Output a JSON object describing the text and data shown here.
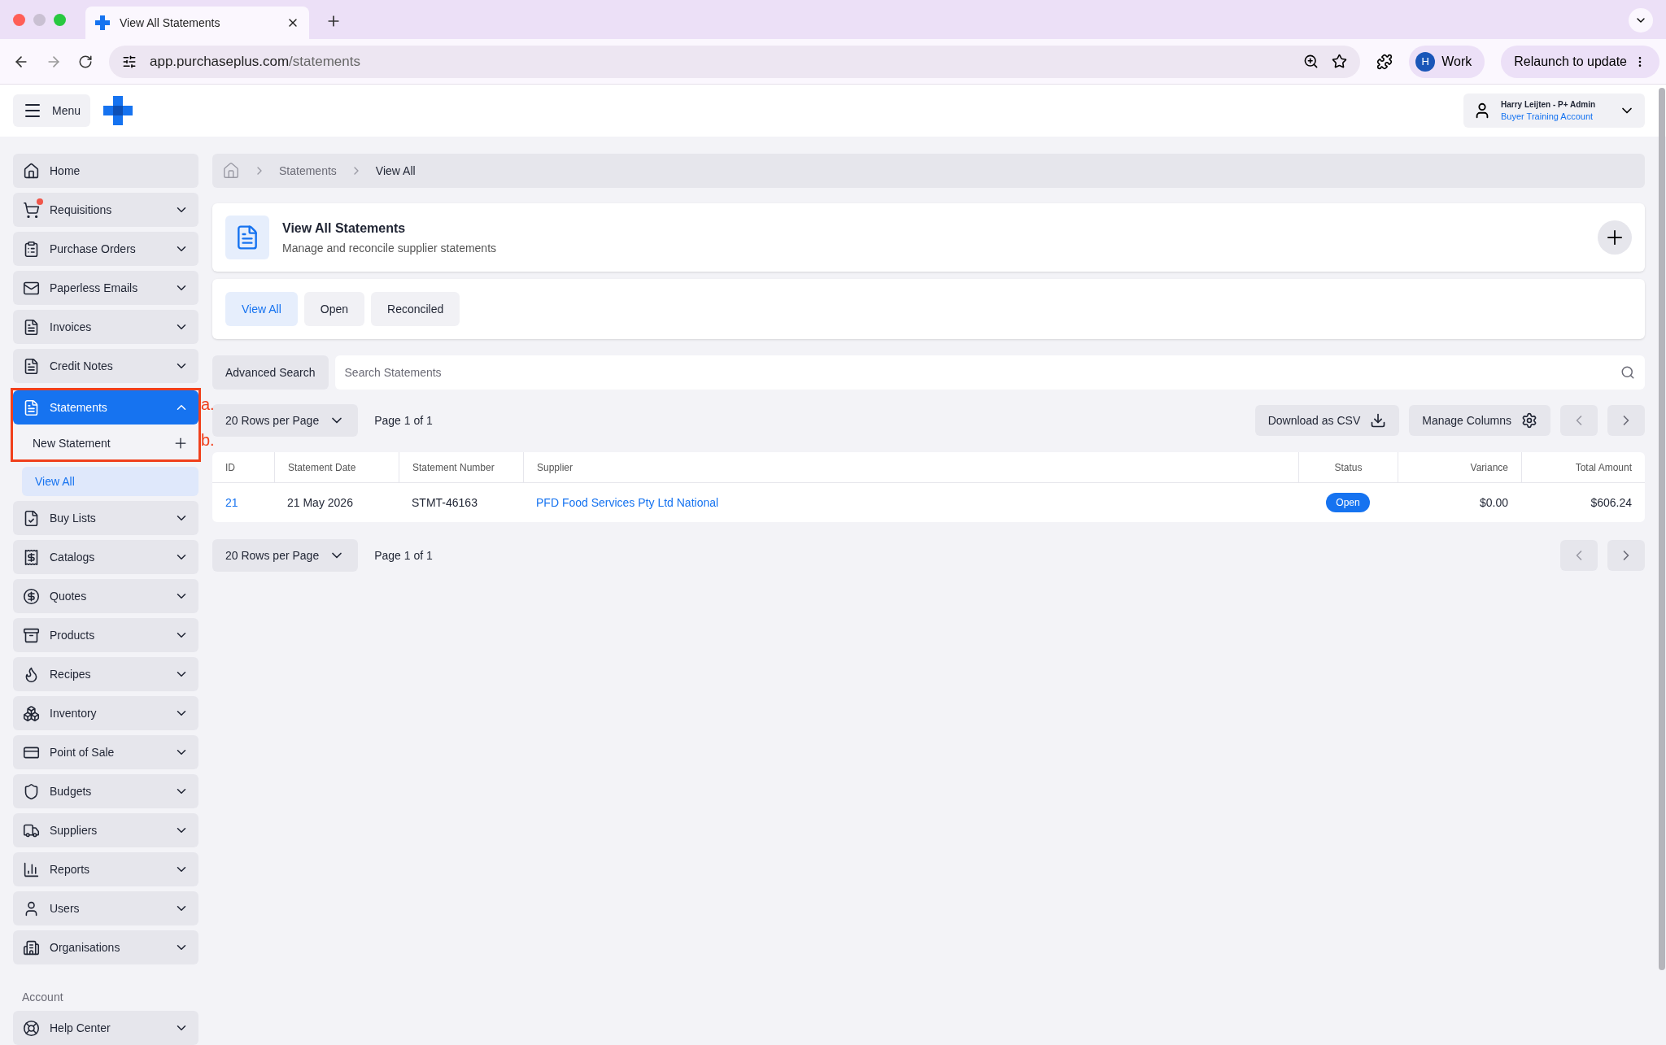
{
  "browser": {
    "tab_title": "View All Statements",
    "url_domain": "app.purchaseplus.com",
    "url_path": "/statements",
    "profile_initial": "H",
    "profile_name": "Work",
    "relaunch": "Relaunch to update"
  },
  "header": {
    "menu_label": "Menu",
    "user_name": "Harry Leijten - P+ Admin",
    "account": "Buyer Training Account"
  },
  "sidebar": {
    "items": [
      {
        "label": "Home",
        "expandable": false,
        "selected": false,
        "alert": false
      },
      {
        "label": "Requisitions",
        "expandable": true,
        "expanded": false,
        "selected": false,
        "alert": true
      },
      {
        "label": "Purchase Orders",
        "expandable": true,
        "expanded": false,
        "selected": false,
        "alert": false
      },
      {
        "label": "Paperless Emails",
        "expandable": true,
        "expanded": false,
        "selected": false,
        "alert": false
      },
      {
        "label": "Invoices",
        "expandable": true,
        "expanded": false,
        "selected": false,
        "alert": false
      },
      {
        "label": "Credit Notes",
        "expandable": true,
        "expanded": false,
        "selected": false,
        "alert": false
      },
      {
        "label": "Statements",
        "expandable": true,
        "expanded": true,
        "selected": true,
        "alert": false,
        "children": [
          {
            "label": "New Statement",
            "kind": "action",
            "selected": false
          },
          {
            "label": "View All",
            "kind": "link",
            "selected": true
          }
        ]
      },
      {
        "label": "Buy Lists",
        "expandable": true,
        "expanded": false,
        "selected": false,
        "alert": false
      },
      {
        "label": "Catalogs",
        "expandable": true,
        "expanded": false,
        "selected": false,
        "alert": false
      },
      {
        "label": "Quotes",
        "expandable": true,
        "expanded": false,
        "selected": false,
        "alert": false
      },
      {
        "label": "Products",
        "expandable": true,
        "expanded": false,
        "selected": false,
        "alert": false
      },
      {
        "label": "Recipes",
        "expandable": true,
        "expanded": false,
        "selected": false,
        "alert": false
      },
      {
        "label": "Inventory",
        "expandable": true,
        "expanded": false,
        "selected": false,
        "alert": false
      },
      {
        "label": "Point of Sale",
        "expandable": true,
        "expanded": false,
        "selected": false,
        "alert": false
      },
      {
        "label": "Budgets",
        "expandable": true,
        "expanded": false,
        "selected": false,
        "alert": false
      },
      {
        "label": "Suppliers",
        "expandable": true,
        "expanded": false,
        "selected": false,
        "alert": false
      },
      {
        "label": "Reports",
        "expandable": true,
        "expanded": false,
        "selected": false,
        "alert": false
      },
      {
        "label": "Users",
        "expandable": true,
        "expanded": false,
        "selected": false,
        "alert": false
      },
      {
        "label": "Organisations",
        "expandable": true,
        "expanded": false,
        "selected": false,
        "alert": false
      }
    ],
    "section_label": "Account",
    "account_items": [
      {
        "label": "Help Center",
        "expandable": true,
        "expanded": false,
        "selected": false,
        "alert": false
      }
    ]
  },
  "annotations": [
    "a.",
    "b."
  ],
  "breadcrumb": [
    "Statements",
    "View All"
  ],
  "page": {
    "title": "View All Statements",
    "subtitle": "Manage and reconcile supplier statements"
  },
  "tabs": [
    {
      "label": "View All",
      "selected": true
    },
    {
      "label": "Open",
      "selected": false
    },
    {
      "label": "Reconciled",
      "selected": false
    }
  ],
  "search": {
    "advanced": "Advanced Search",
    "placeholder": "Search Statements"
  },
  "pager": {
    "rows_per_page": "20 Rows per Page",
    "page": "Page 1 of 1",
    "download": "Download as CSV",
    "manage": "Manage Columns"
  },
  "table": {
    "columns": [
      "ID",
      "Statement Date",
      "Statement Number",
      "Supplier",
      "Status",
      "Variance",
      "Total Amount"
    ],
    "rows": [
      {
        "id": "21",
        "date": "21 May 2026",
        "number": "STMT-46163",
        "supplier": "PFD Food Services Pty Ltd National",
        "status": "Open",
        "variance": "$0.00",
        "total": "$606.24"
      }
    ]
  },
  "bottom_pager": {
    "rows_per_page": "20 Rows per Page",
    "page": "Page 1 of 1"
  }
}
